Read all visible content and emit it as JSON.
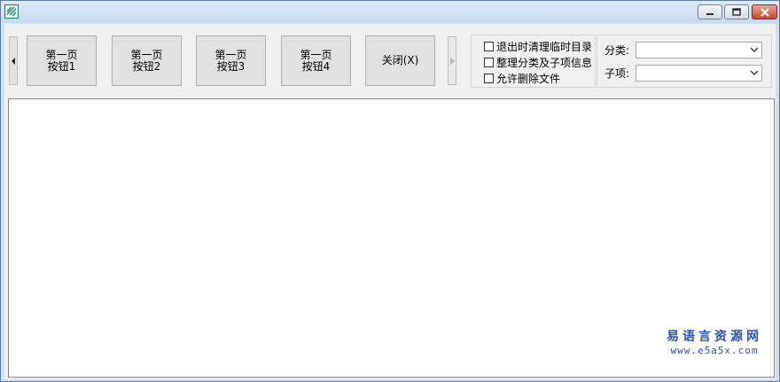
{
  "window": {
    "controls": {
      "minimize_icon": "minimize-icon",
      "maximize_icon": "maximize-icon",
      "close_icon": "close-icon"
    }
  },
  "toolbar": {
    "buttons": [
      {
        "line1": "第一页",
        "line2": "按钮1"
      },
      {
        "line1": "第一页",
        "line2": "按钮2"
      },
      {
        "line1": "第一页",
        "line2": "按钮3"
      },
      {
        "line1": "第一页",
        "line2": "按钮4"
      },
      {
        "line1": "关闭(X)",
        "line2": ""
      }
    ]
  },
  "options": {
    "items": [
      {
        "label": "退出时清理临时目录",
        "checked": false
      },
      {
        "label": "整理分类及子项信息",
        "checked": false
      },
      {
        "label": "允许删除文件",
        "checked": false
      }
    ]
  },
  "filters": {
    "category_label": "分类:",
    "category_value": "",
    "subitem_label": "子项:",
    "subitem_value": ""
  },
  "watermark": {
    "cn": "易语言资源网",
    "en": "www.e5a5x.com"
  },
  "colors": {
    "accent": "#2a4fb8",
    "titlebar": "#cfe0f2",
    "close": "#c44a31"
  }
}
